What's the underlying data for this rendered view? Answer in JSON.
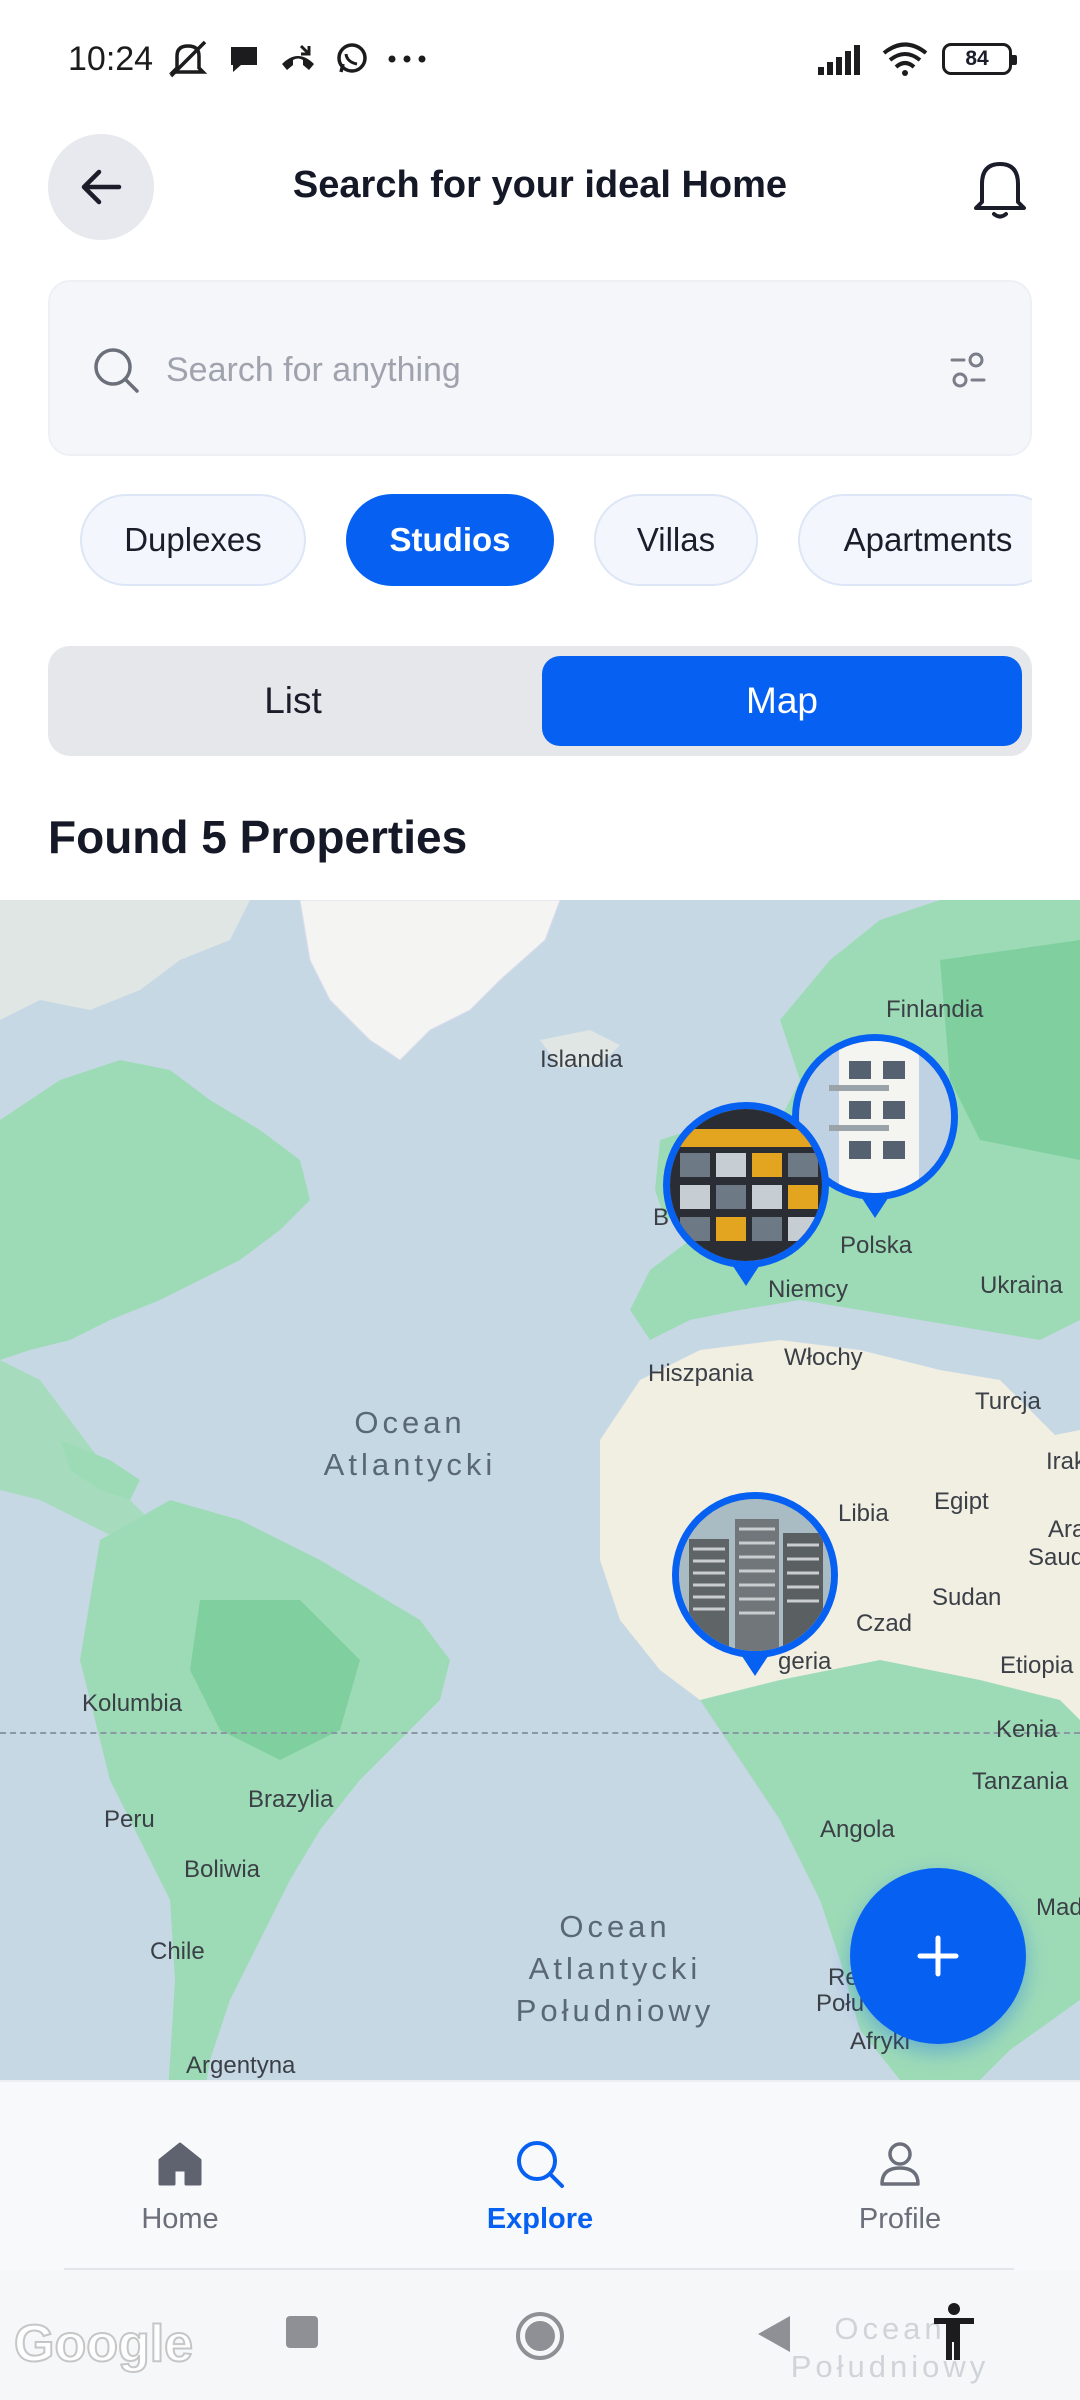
{
  "status_bar": {
    "time": "10:24",
    "battery": "84",
    "icons_left": [
      "mute-icon",
      "chat-icon",
      "call-icon",
      "whatsapp-icon",
      "more-icon"
    ],
    "icons_right": [
      "signal-icon",
      "wifi-icon",
      "battery-icon"
    ]
  },
  "header": {
    "title": "Search for your ideal Home",
    "back_icon": "arrow-left-icon",
    "notification_icon": "bell-icon"
  },
  "search": {
    "placeholder": "Search for anything",
    "value": ""
  },
  "chips": [
    {
      "label": "Duplexes",
      "active": false
    },
    {
      "label": "Studios",
      "active": true
    },
    {
      "label": "Villas",
      "active": false
    },
    {
      "label": "Apartments",
      "active": false
    }
  ],
  "view_toggle": {
    "list_label": "List",
    "map_label": "Map",
    "selected": "Map"
  },
  "results": {
    "title": "Found 5 Properties"
  },
  "map": {
    "labels": {
      "finlandia": "Finlandia",
      "islandia": "Islandia",
      "polska": "Polska",
      "ukraina": "Ukraina",
      "niemcy": "Niemcy",
      "wlochy": "Włochy",
      "hiszpania": "Hiszpania",
      "turcja": "Turcja",
      "irak": "Irak",
      "libia": "Libia",
      "egipt": "Egipt",
      "ara": "Ara",
      "saud": "Saud",
      "sudan": "Sudan",
      "czad": "Czad",
      "nigeria": "geria",
      "etiopia": "Etiopia",
      "kenia": "Kenia",
      "tanzania": "Tanzania",
      "angola": "Angola",
      "mad": "Mad",
      "kolumbia": "Kolumbia",
      "peru": "Peru",
      "brazylia": "Brazylia",
      "boliwia": "Boliwia",
      "chile": "Chile",
      "argentyna": "Argentyna",
      "b": "B",
      "re": "Re",
      "polu": "Połu",
      "afryki": "Afryki"
    },
    "oceans": {
      "atlantic_line1": "Ocean",
      "atlantic_line2": "Atlantycki",
      "south_line1": "Ocean",
      "south_line2": "Atlantycki",
      "south_line3": "Południowy",
      "bottom_line1": "Ocean",
      "bottom_line2": "Południowy"
    },
    "attribution": "Google"
  },
  "fab": {
    "icon": "plus-icon"
  },
  "bottom_nav": [
    {
      "label": "Home",
      "icon": "home-icon",
      "active": false
    },
    {
      "label": "Explore",
      "icon": "search-icon",
      "active": true
    },
    {
      "label": "Profile",
      "icon": "profile-icon",
      "active": false
    }
  ],
  "colors": {
    "accent": "#0661f3",
    "map_water": "#c7d8e5",
    "map_land": "#9ddbb7",
    "map_desert": "#f1eee2"
  }
}
